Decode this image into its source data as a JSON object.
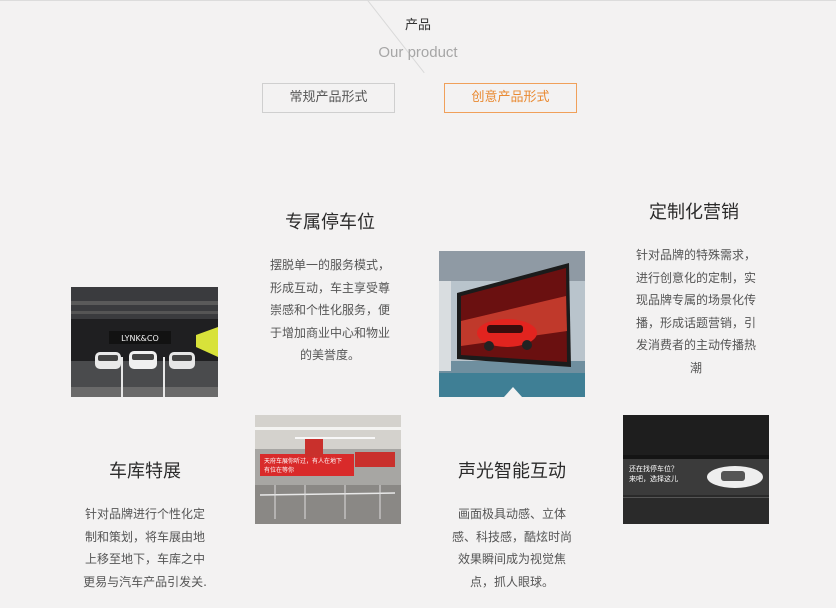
{
  "section": {
    "title_cn": "产品",
    "title_en": "Our product"
  },
  "tabs": [
    {
      "label": "常规产品形式",
      "active": false
    },
    {
      "label": "创意产品形式",
      "active": true
    }
  ],
  "colors": {
    "accent": "#e98a32",
    "background": "#f3f2f2"
  },
  "features": [
    {
      "title": "专属停车位",
      "desc_lines": [
        "摆脱单一的服务模式，",
        "形成互动，车主享受尊",
        "崇感和个性化服务，便",
        "于增加商业中心和物业",
        "的美誉度。"
      ]
    },
    {
      "title": "定制化营销",
      "desc_lines": [
        "针对品牌的特殊需求，",
        "进行创意化的定制，实",
        "现品牌专属的场景化传",
        "播，形成话题营销，引",
        "发消费者的主动传播热",
        "潮"
      ]
    },
    {
      "title": "车库特展",
      "desc_lines": [
        "针对品牌进行个性化定",
        "制和策划，将车展由地",
        "上移至地下，车库之中",
        "更易与汽车产品引发关."
      ]
    },
    {
      "title": "声光智能互动",
      "desc_lines": [
        "画面极具动感、立体",
        "感、科技感，酷炫时尚",
        "效果瞬间成为视觉焦",
        "点，抓人眼球。"
      ]
    }
  ],
  "photos": {
    "parking": {
      "sign_text": "LYNK&CO"
    },
    "garage": {
      "banner_text": "天府车展你听过，有人在地下",
      "banner_text2": "看过车展？",
      "banner_small": "有位在等你"
    },
    "interactive": {
      "screen_text": "还在找停车位？",
      "screen_text2": "来吧，选择这儿"
    }
  }
}
